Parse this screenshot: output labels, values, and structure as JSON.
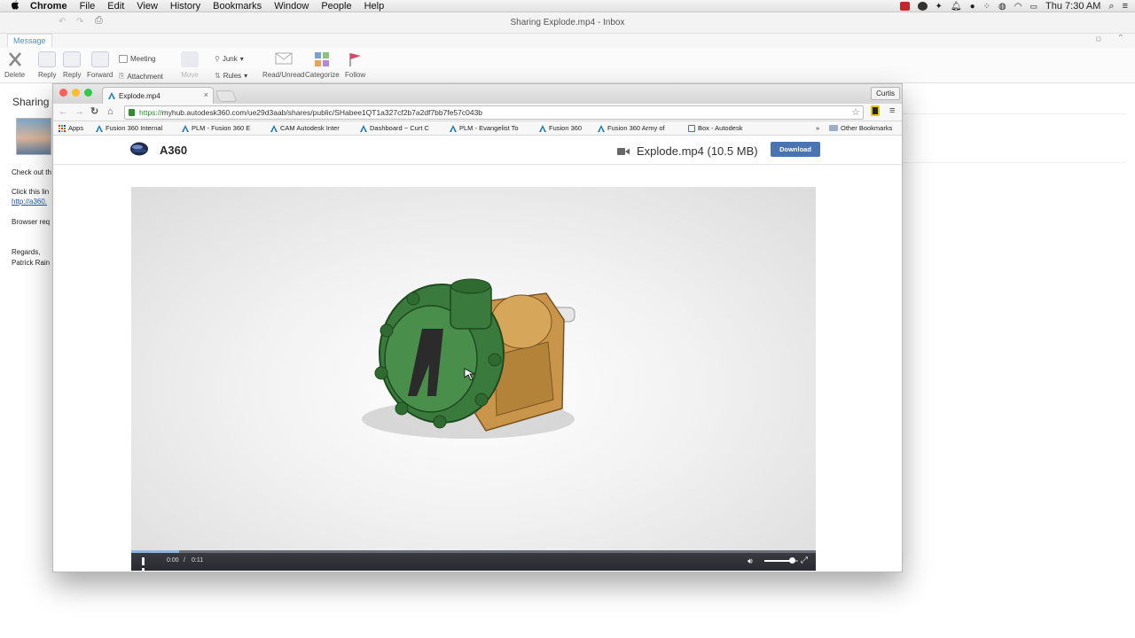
{
  "menubar": {
    "apple": "",
    "items": [
      "Chrome",
      "File",
      "Edit",
      "View",
      "History",
      "Bookmarks",
      "Window",
      "People",
      "Help"
    ],
    "clock": "Thu 7:30 AM"
  },
  "outlook": {
    "window_title": "Sharing Explode.mp4 - Inbox",
    "tab": "Message",
    "ribbon": {
      "delete": "Delete",
      "reply": "Reply",
      "reply_all": "Reply",
      "forward": "Forward",
      "meeting": "Meeting",
      "attachment": "Attachment",
      "move": "Move",
      "junk": "Junk",
      "rules": "Rules",
      "read_unread": "Read/Unread",
      "categorize": "Categorize",
      "follow": "Follow"
    },
    "mail": {
      "subject": "Sharing",
      "line1": "Check out th",
      "line2": "Click this lin",
      "link": "http://a360.",
      "line3": "Browser req",
      "regards": "Regards,",
      "sender": "Patrick Rain"
    }
  },
  "chrome": {
    "tab_title": "Explode.mp4",
    "tab_close": "×",
    "profile": "Curtis",
    "url_scheme": "https://",
    "url_rest": "myhub.autodesk360.com/ue29d3aab/shares/public/SHabee1QT1a327cf2b7a2df7bb7fe57c043b",
    "bookmarks": [
      "Apps",
      "Fusion 360 Internal",
      "PLM - Fusion 360 E",
      "CAM Autodesk Inter",
      "Dashboard ~ Curt C",
      "PLM - Evangelist To",
      "Fusion 360",
      "Fusion 360 Army of",
      "Box - Autodesk",
      "»",
      "Other Bookmarks"
    ]
  },
  "page": {
    "brand": "A360",
    "file_title": "Explode.mp4  (10.5 MB)",
    "download": "Download",
    "video": {
      "current_time": "0:00",
      "separator": "/",
      "total_time": "0:11",
      "progress": 0.07,
      "volume": 0.85
    }
  },
  "colors": {
    "accent": "#4a74b1",
    "traffic_close": "#fc5f57",
    "traffic_min": "#fdbc2e",
    "traffic_max": "#34c84a"
  }
}
